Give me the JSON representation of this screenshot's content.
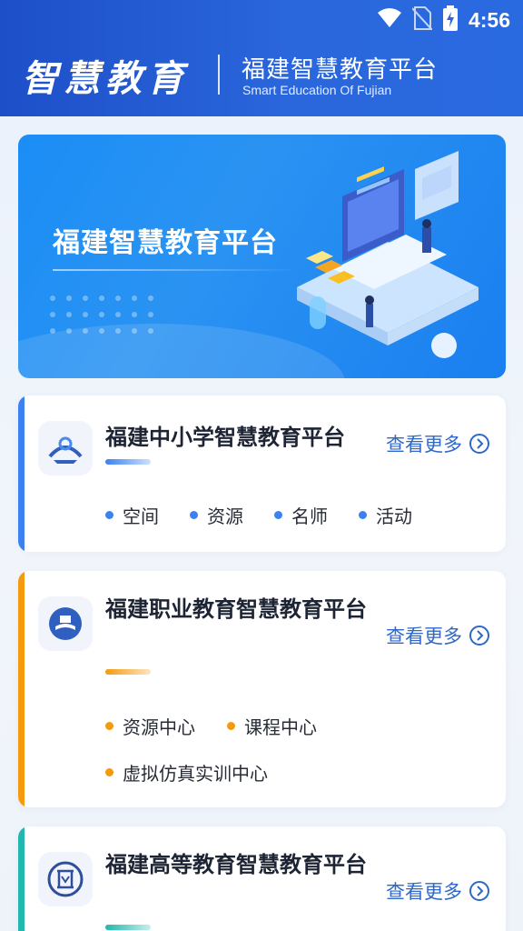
{
  "status": {
    "time": "4:56"
  },
  "header": {
    "logo_text": "智慧教育",
    "title": "福建智慧教育平台",
    "subtitle": "Smart Education Of Fujian"
  },
  "banner": {
    "title": "福建智慧教育平台"
  },
  "cards": [
    {
      "title": "福建中小学智慧教育平台",
      "more": "查看更多",
      "accent": "#3b82f0",
      "tags": [
        "空间",
        "资源",
        "名师",
        "活动"
      ]
    },
    {
      "title": "福建职业教育智慧教育平台",
      "more": "查看更多",
      "accent": "#f59a0c",
      "tags": [
        "资源中心",
        "课程中心",
        "虚拟仿真实训中心"
      ]
    },
    {
      "title": "福建高等教育智慧教育平台",
      "more": "查看更多",
      "accent": "#20b7ae",
      "tags": []
    }
  ],
  "icons": [
    "wifi-icon",
    "no-sim-icon",
    "battery-charging-icon",
    "chevron-right-icon"
  ]
}
